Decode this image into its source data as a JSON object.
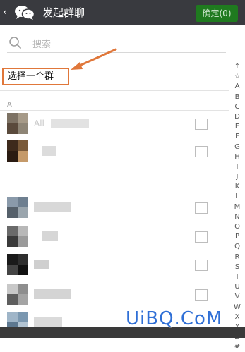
{
  "header": {
    "back_label": "‹",
    "title": "发起群聊",
    "confirm_label": "确定(0)"
  },
  "search": {
    "placeholder": "搜索"
  },
  "select_group_label": "选择一个群",
  "section_label": "A",
  "index_letters": [
    "↑",
    "☆",
    "A",
    "B",
    "C",
    "D",
    "E",
    "F",
    "G",
    "H",
    "I",
    "J",
    "K",
    "L",
    "M",
    "N",
    "O",
    "P",
    "Q",
    "R",
    "S",
    "T",
    "U",
    "V",
    "W",
    "X",
    "Y",
    "Z",
    "#"
  ],
  "contacts": [
    {
      "name": "All",
      "checked": false
    },
    {
      "name": "",
      "checked": false
    },
    {
      "name": "",
      "checked": false
    },
    {
      "name": "",
      "checked": false
    },
    {
      "name": "",
      "checked": false
    },
    {
      "name": "",
      "checked": false
    },
    {
      "name": "",
      "checked": false
    }
  ],
  "watermark": "UiBQ.CoM",
  "colors": {
    "header_bg": "#393a3f",
    "confirm_button_bg": "#1f7a1f",
    "highlight_border": "#e0773a",
    "watermark": "#2f6fd6"
  }
}
